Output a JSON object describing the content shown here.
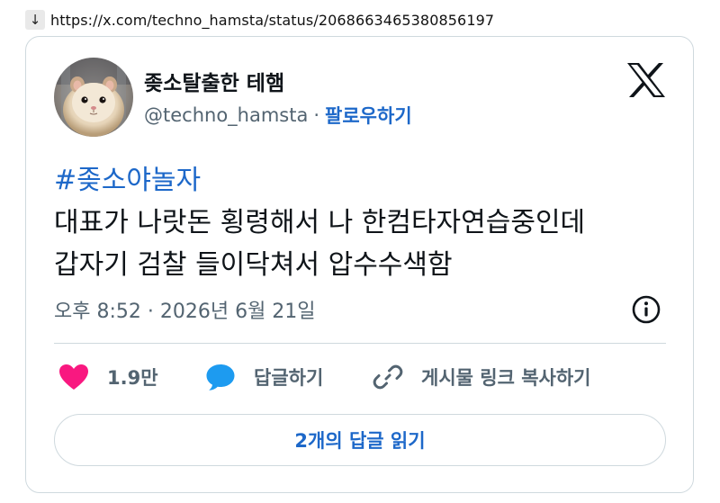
{
  "address_bar": {
    "arrow": "↓",
    "url": "https://x.com/techno_hamsta/status/2068663465380856197"
  },
  "author": {
    "display_name": "좆소탈출한 테햄",
    "handle": "@techno_hamsta",
    "separator": "·",
    "follow_label": "팔로우하기"
  },
  "tweet": {
    "hashtag": "#좆소야놀자",
    "line1": "대표가 나랏돈 횡령해서 나 한컴타자연습중인데",
    "line2": "갑자기 검찰 들이닥쳐서 압수수색함"
  },
  "timestamp": "오후 8:52 · 2026년 6월 21일",
  "actions": {
    "like_count": "1.9만",
    "reply_label": "답글하기",
    "copy_link_label": "게시물 링크 복사하기"
  },
  "read_replies_label": "2개의 답글 읽기",
  "colors": {
    "accent": "#1d68c9",
    "like": "#f91880",
    "muted": "#536471",
    "border": "#cfd9de"
  },
  "icons": [
    "download-arrow-icon",
    "x-logo-icon",
    "info-icon",
    "heart-icon",
    "reply-bubble-icon",
    "link-icon"
  ]
}
